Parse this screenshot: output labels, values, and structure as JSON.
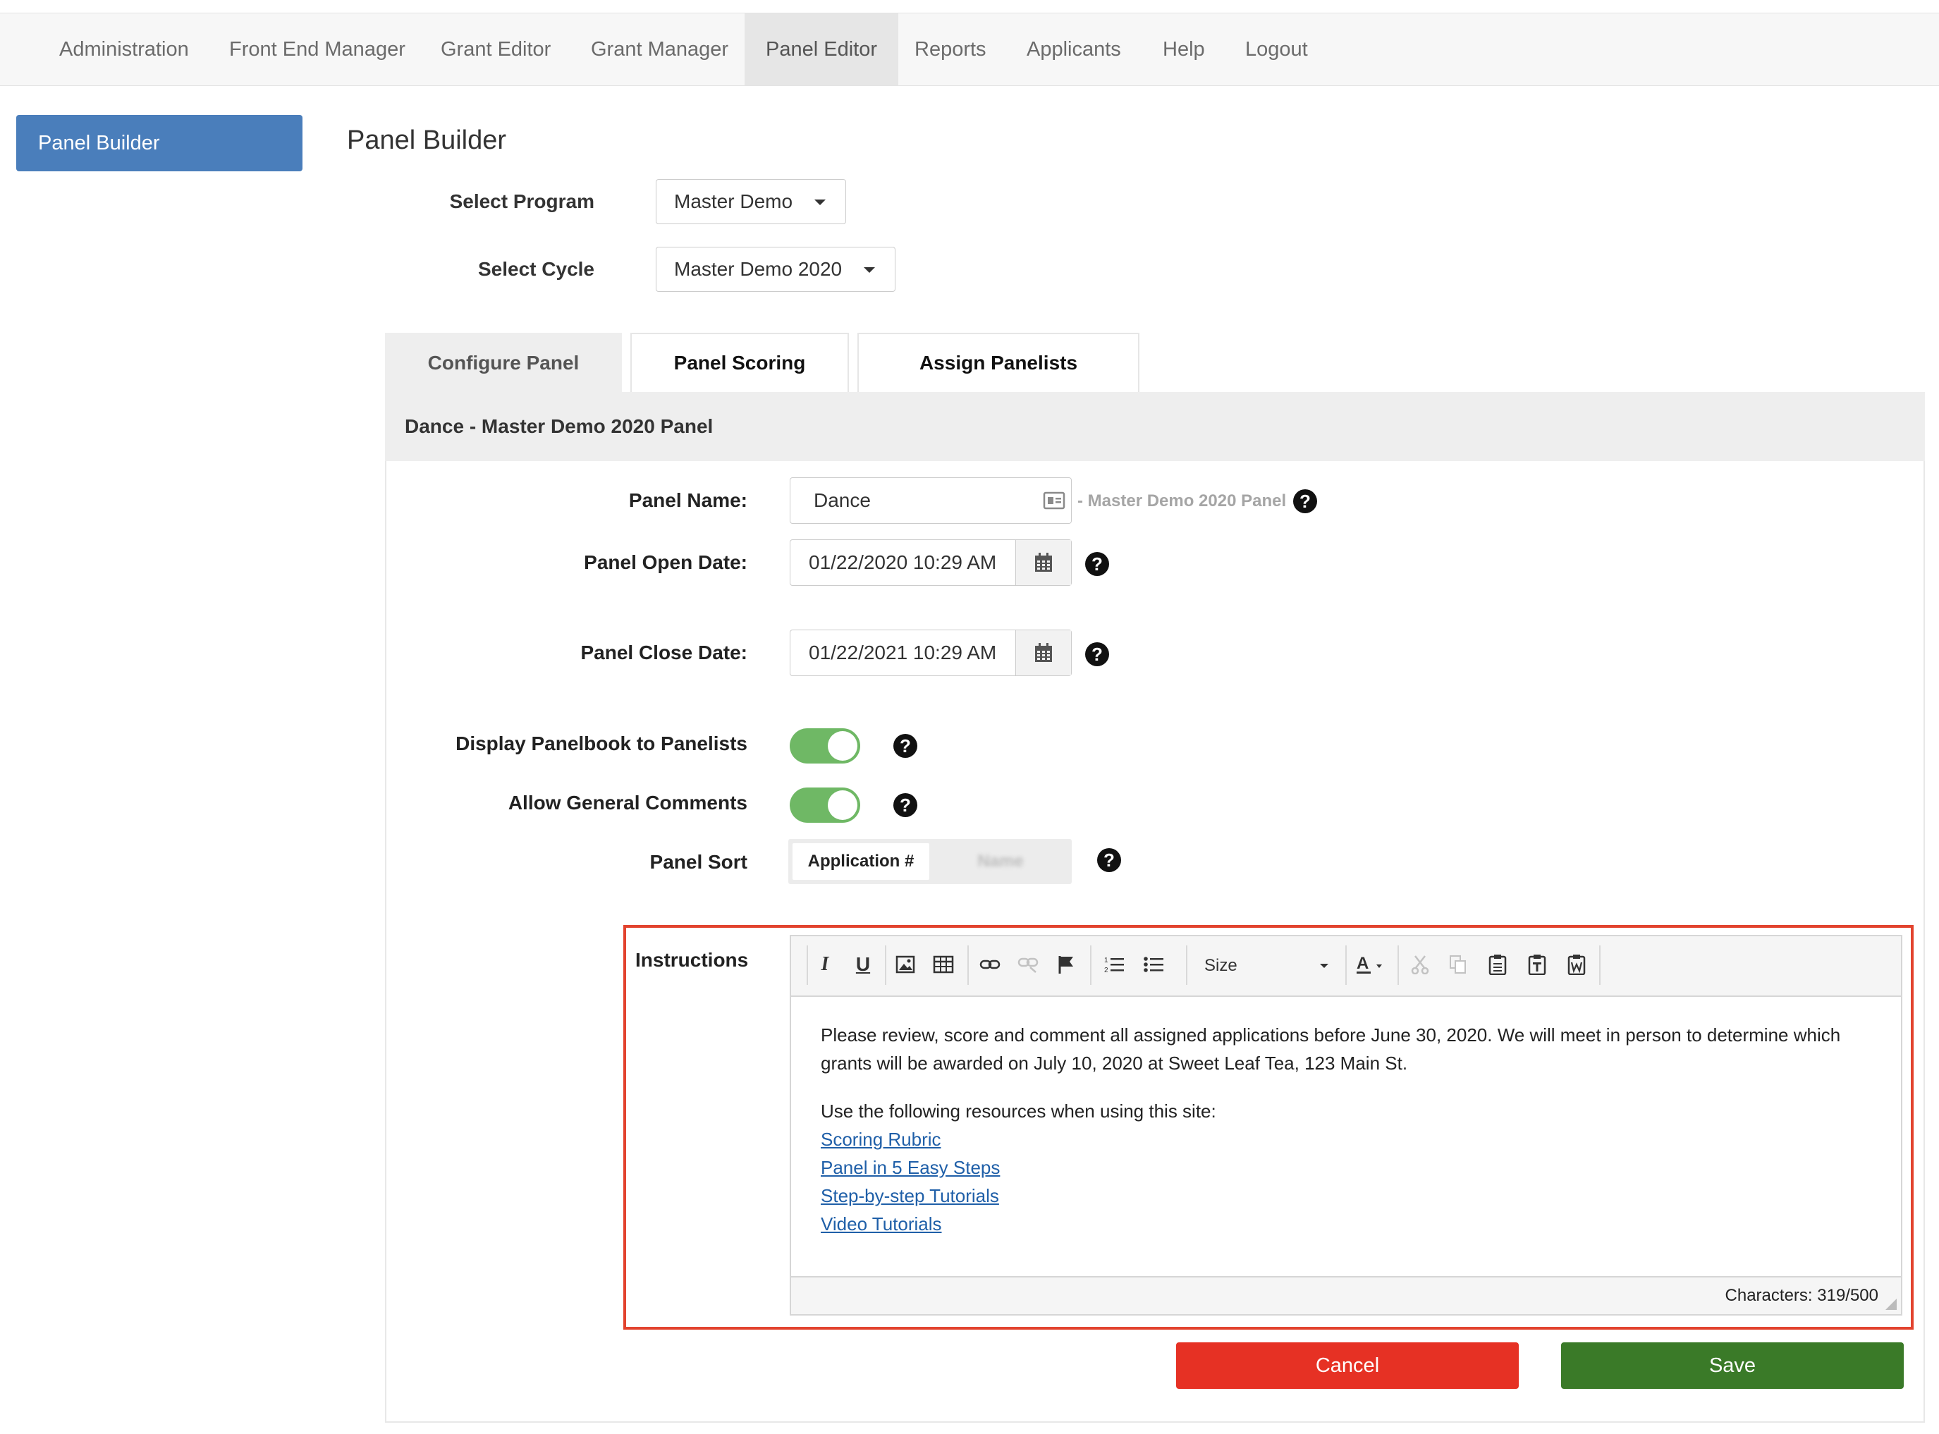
{
  "nav": {
    "items": [
      {
        "label": "Administration"
      },
      {
        "label": "Front End Manager"
      },
      {
        "label": "Grant Editor"
      },
      {
        "label": "Grant Manager"
      },
      {
        "label": "Panel Editor"
      },
      {
        "label": "Reports"
      },
      {
        "label": "Applicants"
      },
      {
        "label": "Help"
      },
      {
        "label": "Logout"
      }
    ],
    "active": "Panel Editor"
  },
  "sidebar": {
    "button_label": "Panel Builder"
  },
  "page": {
    "title": "Panel Builder",
    "select_program": {
      "label": "Select Program",
      "value": "Master Demo"
    },
    "select_cycle": {
      "label": "Select Cycle",
      "value": "Master Demo 2020"
    }
  },
  "tabs": [
    {
      "label": "Configure Panel"
    },
    {
      "label": "Panel Scoring"
    },
    {
      "label": "Assign Panelists"
    }
  ],
  "panel": {
    "header": "Dance - Master Demo 2020 Panel",
    "name_label": "Panel Name:",
    "name_value": "Dance",
    "name_suffix": "- Master Demo 2020 Panel",
    "open_label": "Panel Open Date:",
    "open_value": "01/22/2020 10:29 AM",
    "close_label": "Panel Close Date:",
    "close_value": "01/22/2021 10:29 AM",
    "display_panelbook_label": "Display Panelbook to Panelists",
    "display_panelbook_on": true,
    "allow_comments_label": "Allow General Comments",
    "allow_comments_on": true,
    "sort_label": "Panel Sort",
    "sort_options": [
      "Application #",
      "Name"
    ],
    "sort_selected": "Application #",
    "help_glyph": "?"
  },
  "instructions": {
    "label": "Instructions",
    "size_label": "Size",
    "paragraph1": "Please review, score and comment all assigned applications before June 30, 2020.  We will meet in person to determine which grants will be awarded on July 10, 2020 at Sweet Leaf Tea, 123 Main St.",
    "paragraph2": "Use the following resources when using this site:",
    "links": [
      "Scoring Rubric",
      "Panel in 5 Easy Steps",
      "Step-by-step Tutorials",
      "Video Tutorials"
    ],
    "char_count": "Characters: 319/500"
  },
  "actions": {
    "cancel": "Cancel",
    "save": "Save"
  },
  "colors": {
    "accent_blue": "#4a7ebb",
    "toggle_green": "#6fb865",
    "cancel_red": "#e63124",
    "save_green": "#3a7a28",
    "highlight_red": "#e2432e",
    "link_blue": "#1f5fa8"
  }
}
